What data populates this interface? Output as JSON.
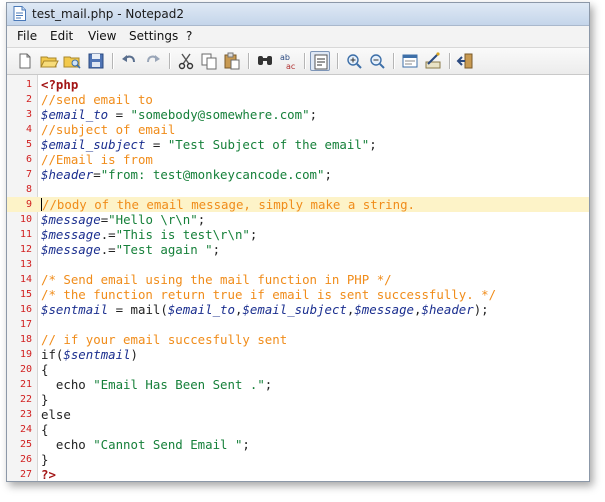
{
  "window": {
    "title": "test_mail.php - Notepad2"
  },
  "menu": [
    "File",
    "Edit",
    "View",
    "Settings",
    "?"
  ],
  "toolbar": {
    "buttons": [
      "new-file-icon",
      "open-icon",
      "browse-icon",
      "save-icon",
      "undo-icon",
      "redo-icon",
      "cut-icon",
      "copy-icon",
      "paste-icon",
      "find-icon",
      "replace-icon",
      "word-wrap-icon",
      "zoom-in-icon",
      "zoom-out-icon",
      "scheme-icon",
      "customize-icon",
      "exit-icon"
    ]
  },
  "editor": {
    "current_line": 9,
    "colors": {
      "comment": "#f08c1a",
      "variable": "#1b2f8f",
      "string": "#16803a",
      "php_tag": "#a31515",
      "line_number": "#d12020",
      "current_line_bg": "#fdf3c8"
    },
    "lines": [
      {
        "n": "1",
        "parts": [
          [
            "php",
            "<?php"
          ]
        ]
      },
      {
        "n": "2",
        "parts": [
          [
            "cmt",
            "//send email to"
          ]
        ]
      },
      {
        "n": "3",
        "parts": [
          [
            "var",
            "$email_to"
          ],
          [
            "op",
            " = "
          ],
          [
            "str",
            "\"somebody@somewhere.com\""
          ],
          [
            "op",
            ";"
          ]
        ]
      },
      {
        "n": "4",
        "parts": [
          [
            "cmt",
            "//subject of email"
          ]
        ]
      },
      {
        "n": "5",
        "parts": [
          [
            "var",
            "$email_subject"
          ],
          [
            "op",
            " = "
          ],
          [
            "str",
            "\"Test Subject of the email\""
          ],
          [
            "op",
            ";"
          ]
        ]
      },
      {
        "n": "6",
        "parts": [
          [
            "cmt",
            "//Email is from"
          ]
        ]
      },
      {
        "n": "7",
        "parts": [
          [
            "var",
            "$header"
          ],
          [
            "op",
            "="
          ],
          [
            "str",
            "\"from: test@monkeycancode.com\""
          ],
          [
            "op",
            ";"
          ]
        ]
      },
      {
        "n": "8",
        "parts": []
      },
      {
        "n": "9",
        "parts": [
          [
            "cmt",
            "//body of the email message, simply make a string."
          ]
        ]
      },
      {
        "n": "10",
        "parts": [
          [
            "var",
            "$message"
          ],
          [
            "op",
            "="
          ],
          [
            "str",
            "\"Hello \\r\\n\""
          ],
          [
            "op",
            ";"
          ]
        ]
      },
      {
        "n": "11",
        "parts": [
          [
            "var",
            "$message"
          ],
          [
            "op",
            ".="
          ],
          [
            "str",
            "\"This is test\\r\\n\""
          ],
          [
            "op",
            ";"
          ]
        ]
      },
      {
        "n": "12",
        "parts": [
          [
            "var",
            "$message"
          ],
          [
            "op",
            ".="
          ],
          [
            "str",
            "\"Test again \""
          ],
          [
            "op",
            ";"
          ]
        ]
      },
      {
        "n": "13",
        "parts": []
      },
      {
        "n": "14",
        "parts": [
          [
            "cmt",
            "/* Send email using the mail function in PHP */"
          ]
        ]
      },
      {
        "n": "15",
        "parts": [
          [
            "cmt",
            "/* the function return true if email is sent successfully. */"
          ]
        ]
      },
      {
        "n": "16",
        "parts": [
          [
            "var",
            "$sentmail"
          ],
          [
            "op",
            " = mail("
          ],
          [
            "var",
            "$email_to"
          ],
          [
            "op",
            ","
          ],
          [
            "var",
            "$email_subject"
          ],
          [
            "op",
            ","
          ],
          [
            "var",
            "$message"
          ],
          [
            "op",
            ","
          ],
          [
            "var",
            "$header"
          ],
          [
            "op",
            ");"
          ]
        ]
      },
      {
        "n": "17",
        "parts": []
      },
      {
        "n": "18",
        "parts": [
          [
            "cmt",
            "// if your email succesfully sent"
          ]
        ]
      },
      {
        "n": "19",
        "parts": [
          [
            "kw",
            "if("
          ],
          [
            "var",
            "$sentmail"
          ],
          [
            "kw",
            ")"
          ]
        ]
      },
      {
        "n": "20",
        "parts": [
          [
            "op",
            "{"
          ]
        ]
      },
      {
        "n": "21",
        "parts": [
          [
            "op",
            "  echo "
          ],
          [
            "str",
            "\"Email Has Been Sent .\""
          ],
          [
            "op",
            ";"
          ]
        ]
      },
      {
        "n": "22",
        "parts": [
          [
            "op",
            "}"
          ]
        ]
      },
      {
        "n": "23",
        "parts": [
          [
            "kw",
            "else"
          ]
        ]
      },
      {
        "n": "24",
        "parts": [
          [
            "op",
            "{"
          ]
        ]
      },
      {
        "n": "25",
        "parts": [
          [
            "op",
            "  echo "
          ],
          [
            "str",
            "\"Cannot Send Email \""
          ],
          [
            "op",
            ";"
          ]
        ]
      },
      {
        "n": "26",
        "parts": [
          [
            "op",
            "}"
          ]
        ]
      },
      {
        "n": "27",
        "parts": [
          [
            "php",
            "?>"
          ]
        ]
      }
    ]
  }
}
